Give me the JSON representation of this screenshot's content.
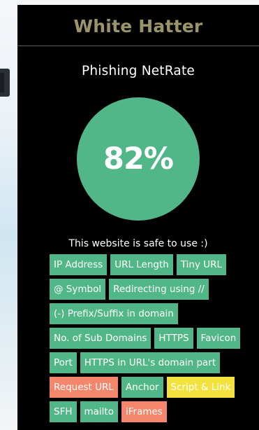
{
  "app": {
    "title": "White Hatter"
  },
  "section": {
    "title": "Phishing NetRate"
  },
  "rate": {
    "value": "82%"
  },
  "verdict": {
    "text": "This website is safe to use :)"
  },
  "features": {
    "rows": [
      [
        {
          "label": "IP Address",
          "status": "safe"
        },
        {
          "label": "URL Length",
          "status": "safe"
        },
        {
          "label": "Tiny URL",
          "status": "safe"
        }
      ],
      [
        {
          "label": "@ Symbol",
          "status": "safe"
        },
        {
          "label": "Redirecting using //",
          "status": "safe"
        }
      ],
      [
        {
          "label": "(-) Prefix/Suffix in domain",
          "status": "safe"
        }
      ],
      [
        {
          "label": "No. of Sub Domains",
          "status": "safe"
        },
        {
          "label": "HTTPS",
          "status": "safe"
        },
        {
          "label": "Favicon",
          "status": "safe"
        }
      ],
      [
        {
          "label": "Port",
          "status": "safe"
        },
        {
          "label": "HTTPS in URL's domain part",
          "status": "safe"
        }
      ],
      [
        {
          "label": "Request URL",
          "status": "phishing"
        },
        {
          "label": "Anchor",
          "status": "safe"
        },
        {
          "label": "Script & Link",
          "status": "suspicious"
        }
      ],
      [
        {
          "label": "SFH",
          "status": "safe"
        },
        {
          "label": "mailto",
          "status": "safe"
        },
        {
          "label": "iFrames",
          "status": "phishing"
        }
      ]
    ]
  },
  "colors": {
    "safe": "#52b788",
    "phishing": "#f4866b",
    "suspicious": "#f3e13d",
    "title": "#9b9468",
    "background": "#000000"
  }
}
